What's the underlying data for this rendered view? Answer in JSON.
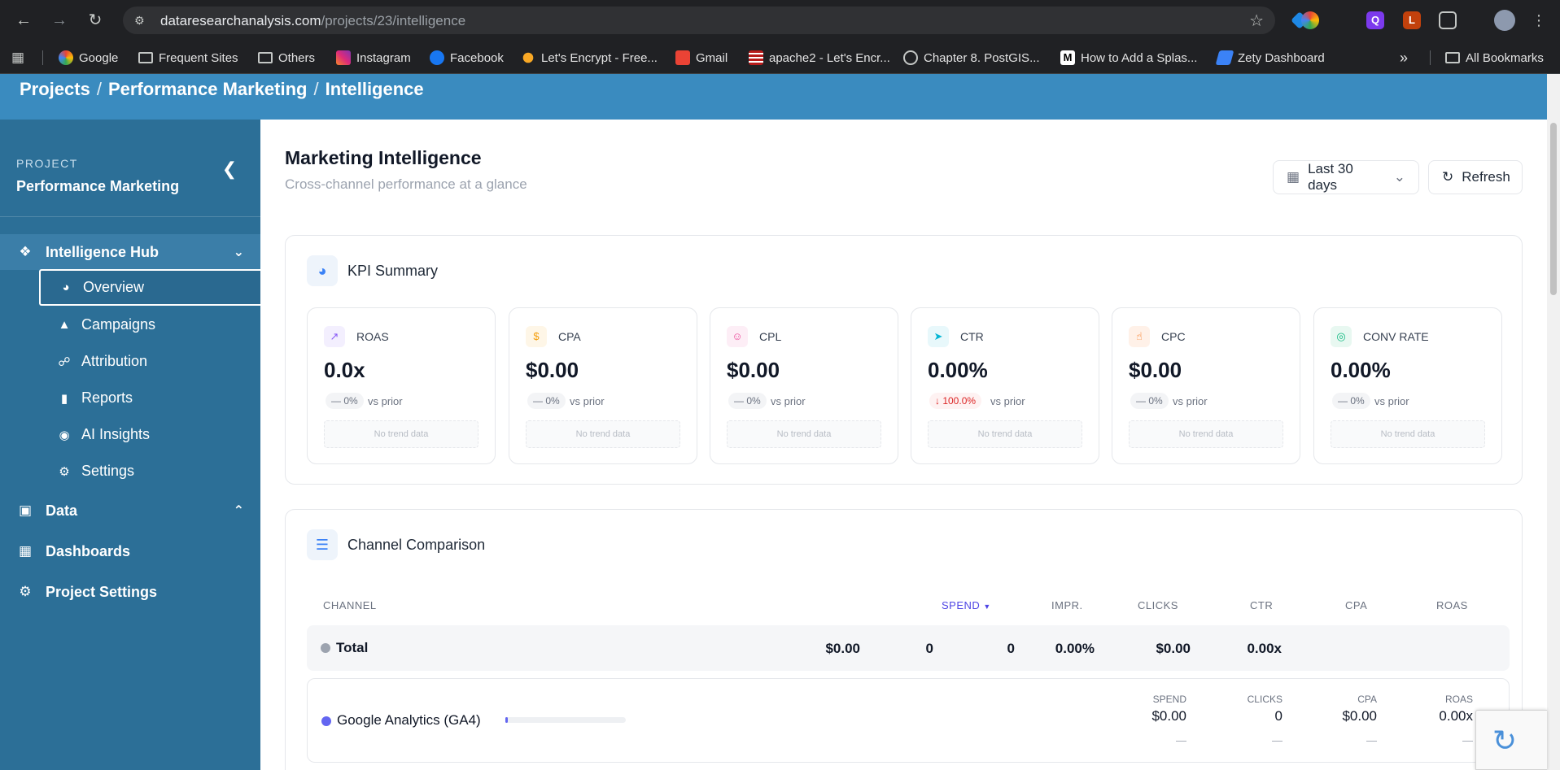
{
  "browser": {
    "url_host": "dataresearchanalysis.com",
    "url_path": "/projects/23/intelligence",
    "bookmarks": [
      "Google",
      "Frequent Sites",
      "Others",
      "Instagram",
      "Facebook",
      "Let's Encrypt - Free...",
      "Gmail",
      "apache2 - Let's Encr...",
      "Chapter 8. PostGIS...",
      "How to Add a Splas...",
      "Zety Dashboard"
    ],
    "all_bookmarks": "All Bookmarks",
    "overflow": "»"
  },
  "breadcrumb": {
    "items": [
      "Projects",
      "Performance Marketing",
      "Intelligence"
    ],
    "separator": "/"
  },
  "sidebar": {
    "project_label": "PROJECT",
    "project_name": "Performance Marketing",
    "hub_label": "Intelligence Hub",
    "sub_items": [
      "Overview",
      "Campaigns",
      "Attribution",
      "Reports",
      "AI Insights",
      "Settings"
    ],
    "active_item": "Overview",
    "data_label": "Data",
    "dashboards_label": "Dashboards",
    "project_settings_label": "Project Settings"
  },
  "main": {
    "title": "Marketing Intelligence",
    "subtitle": "Cross-channel performance at a glance",
    "date_range": "Last 30 days",
    "refresh_label": "Refresh"
  },
  "kpi_summary": {
    "title": "KPI Summary",
    "vs_label": "vs prior",
    "no_trend": "No trend data",
    "cards": [
      {
        "label": "ROAS",
        "value": "0.0x",
        "delta": "— 0%",
        "icon": "trend-line-icon",
        "color": "#8b5cf6"
      },
      {
        "label": "CPA",
        "value": "$0.00",
        "delta": "— 0%",
        "icon": "dollar-icon",
        "color": "#f59e0b"
      },
      {
        "label": "CPL",
        "value": "$0.00",
        "delta": "— 0%",
        "icon": "user-plus-icon",
        "color": "#ec4899"
      },
      {
        "label": "CTR",
        "value": "0.00%",
        "delta": "↓ 100.0%",
        "icon": "cursor-icon",
        "color": "#06b6d4"
      },
      {
        "label": "CPC",
        "value": "$0.00",
        "delta": "— 0%",
        "icon": "hand-pointer-icon",
        "color": "#f97316"
      },
      {
        "label": "CONV RATE",
        "value": "0.00%",
        "delta": "— 0%",
        "icon": "target-icon",
        "color": "#10b981"
      }
    ]
  },
  "channel_comparison": {
    "title": "Channel Comparison",
    "columns": [
      "CHANNEL",
      "SPEND",
      "IMPR.",
      "CLICKS",
      "CTR",
      "CPA",
      "ROAS"
    ],
    "sorted_column": "SPEND",
    "total": {
      "name": "Total",
      "spend": "$0.00",
      "impr": "0",
      "clicks": "0",
      "ctr": "0.00%",
      "cpa": "$0.00",
      "roas": "0.00x"
    },
    "channels": [
      {
        "name": "Google Analytics (GA4)",
        "color": "#6366f1",
        "share": 0.01,
        "metrics": [
          {
            "label": "SPEND",
            "value": "$0.00",
            "sub": "—"
          },
          {
            "label": "CLICKS",
            "value": "0",
            "sub": "—"
          },
          {
            "label": "CPA",
            "value": "$0.00",
            "sub": "—"
          },
          {
            "label": "ROAS",
            "value": "0.00x",
            "sub": "—"
          }
        ]
      }
    ]
  }
}
